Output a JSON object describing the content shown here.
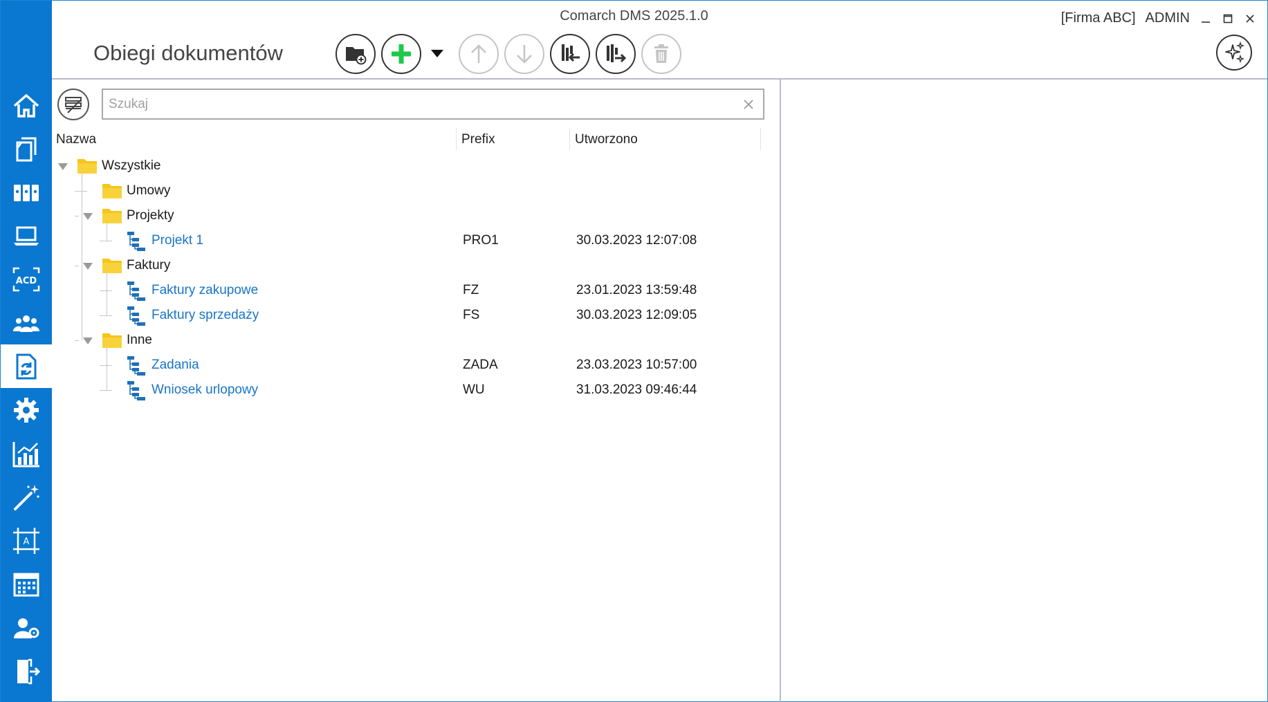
{
  "window": {
    "title": "Comarch DMS 2025.1.0",
    "company": "[Firma ABC]",
    "user": "ADMIN"
  },
  "page": {
    "title": "Obiegi dokumentów"
  },
  "search": {
    "placeholder": "Szukaj",
    "value": ""
  },
  "columns": {
    "name": "Nazwa",
    "prefix": "Prefix",
    "created": "Utworzono"
  },
  "tree": [
    {
      "label": "Wszystkie",
      "type": "folder",
      "level": 0,
      "expandable": true,
      "prefix": "",
      "created": ""
    },
    {
      "label": "Umowy",
      "type": "folder",
      "level": 1,
      "expandable": false,
      "prefix": "",
      "created": ""
    },
    {
      "label": "Projekty",
      "type": "folder",
      "level": 1,
      "expandable": true,
      "prefix": "",
      "created": ""
    },
    {
      "label": "Projekt 1",
      "type": "workflow",
      "level": 2,
      "expandable": false,
      "prefix": "PRO1",
      "created": "30.03.2023 12:07:08"
    },
    {
      "label": "Faktury",
      "type": "folder",
      "level": 1,
      "expandable": true,
      "prefix": "",
      "created": ""
    },
    {
      "label": "Faktury zakupowe",
      "type": "workflow",
      "level": 2,
      "expandable": false,
      "prefix": "FZ",
      "created": "23.01.2023 13:59:48"
    },
    {
      "label": "Faktury sprzedaży",
      "type": "workflow",
      "level": 2,
      "expandable": false,
      "prefix": "FS",
      "created": "30.03.2023 12:09:05"
    },
    {
      "label": "Inne",
      "type": "folder",
      "level": 1,
      "expandable": true,
      "prefix": "",
      "created": ""
    },
    {
      "label": "Zadania",
      "type": "workflow",
      "level": 2,
      "expandable": false,
      "prefix": "ZADA",
      "created": "23.03.2023 10:57:00"
    },
    {
      "label": "Wniosek urlopowy",
      "type": "workflow",
      "level": 2,
      "expandable": false,
      "prefix": "WU",
      "created": "31.03.2023 09:46:44"
    }
  ],
  "sidebar": [
    {
      "name": "home-icon",
      "active": false
    },
    {
      "name": "documents-icon",
      "active": false
    },
    {
      "name": "archive-binders-icon",
      "active": false
    },
    {
      "name": "laptop-icon",
      "active": false
    },
    {
      "name": "ocr-acd-icon",
      "active": false
    },
    {
      "name": "users-icon",
      "active": false
    },
    {
      "name": "workflow-icon",
      "active": true
    },
    {
      "name": "settings-gear-icon",
      "active": false
    },
    {
      "name": "reports-chart-icon",
      "active": false
    },
    {
      "name": "magic-wand-icon",
      "active": false
    },
    {
      "name": "template-designer-icon",
      "active": false
    },
    {
      "name": "calendar-icon",
      "active": false
    },
    {
      "name": "user-settings-icon",
      "active": false
    },
    {
      "name": "logout-door-icon",
      "active": false
    }
  ],
  "colors": {
    "sidebar": "#0a78d0",
    "link": "#1875c8",
    "folder": "#f5c518",
    "add": "#1ec84a"
  }
}
